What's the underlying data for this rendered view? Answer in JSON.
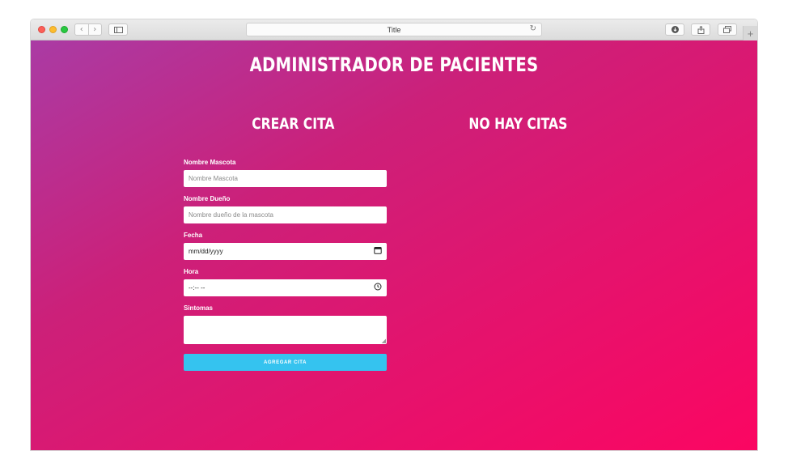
{
  "browser": {
    "tab_title": "Title",
    "back_icon": "chevron-left",
    "forward_icon": "chevron-right",
    "reload_icon": "reload",
    "download_icon": "download",
    "share_icon": "share",
    "tabs_icon": "tabs",
    "newtab_label": "+"
  },
  "app": {
    "title": "ADMINISTRADOR DE PACIENTES",
    "form_title": "CREAR CITA",
    "list_title": "NO HAY CITAS"
  },
  "form": {
    "mascota": {
      "label": "Nombre Mascota",
      "placeholder": "Nombre Mascota"
    },
    "dueno": {
      "label": "Nombre Dueño",
      "placeholder": "Nombre dueño de la mascota"
    },
    "fecha": {
      "label": "Fecha",
      "value": "mm/dd/yyyy"
    },
    "hora": {
      "label": "Hora",
      "value": "--:-- --"
    },
    "sintomas": {
      "label": "Sintomas",
      "value": ""
    },
    "submit_label": "AGREGAR CITA"
  },
  "colors": {
    "gradient_start": "#aa3ba4",
    "gradient_end": "#fb0662",
    "button": "#35c3ef"
  }
}
